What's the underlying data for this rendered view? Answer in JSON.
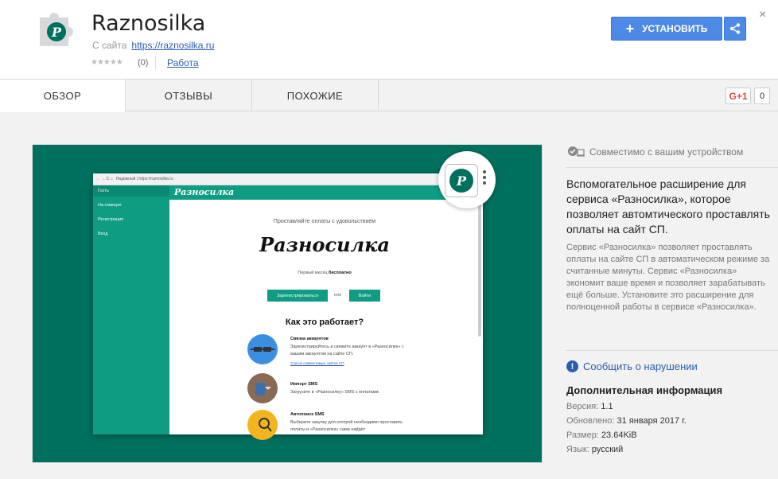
{
  "header": {
    "title": "Raznosilka",
    "from_site_label": "С сайта",
    "from_site_url": "https://raznosilka.ru",
    "rating_stars": "★★★★★",
    "rating_count": "(0)",
    "category": "Работа",
    "install_label": "УСТАНОВИТЬ",
    "close_symbol": "×"
  },
  "tabs": [
    {
      "label": "ОБЗОР",
      "active": true
    },
    {
      "label": "ОТЗЫВЫ",
      "active": false
    },
    {
      "label": "ПОХОЖИЕ",
      "active": false
    }
  ],
  "gplus": {
    "label": "G+1",
    "count": "0"
  },
  "screenshot": {
    "address_bar": "Надежный | https://raznosilka.ru",
    "sidebar_items": [
      "Гость",
      "На главную",
      "Регистрация",
      "Вход"
    ],
    "top_brand": "Разносилка",
    "subtitle": "Проставляйте оплаты с удовольствием",
    "logo": "Разносилка",
    "first_month_prefix": "Первый месяц ",
    "first_month_bold": "бесплатно",
    "register_btn": "Зарегистрироваться",
    "or_text": "или",
    "login_btn": "Войти",
    "how_title": "Как это работает?",
    "steps": [
      {
        "title": "Связка аккаунтов",
        "text": "Зарегистрируйтесь и свяжите аккаунт в «Разносилке» с вашим аккаунтом на сайте СП.",
        "link": "Список совместимых сайтов СП"
      },
      {
        "title": "Импорт SMS",
        "text": "Загрузите в «Разносилку» SMS с оплатами."
      },
      {
        "title": "Автопоиск SMS",
        "text": "Выберите закупку для которой необходимо проставить оплаты и «Разносилка» сама найдёт"
      }
    ],
    "bubble_letter": "P"
  },
  "sidebar": {
    "compat": "Совместимо с вашим устройством",
    "lead": "Вспомогательное расширение для сервиса «Разносилка», которое позволяет автомтического проставлять оплаты на сайт СП.",
    "body": "Сервис «Разносилка» позволяет проставлять оплаты на сайте СП в автоматическом режиме за считанные минуты. Сервис «Разносилка» экономит ваше время и позволяет зарабатывать ещё больше. Установите это расширение для полноценной работы в сервисе «Разносилка».",
    "report": "Сообщить о нарушении",
    "addl_title": "Дополнительная информация",
    "version_label": "Версия:",
    "version": "1.1",
    "updated_label": "Обновлено:",
    "updated": "31 января 2017 г.",
    "size_label": "Размер:",
    "size": "23.64KiB",
    "lang_label": "Язык:",
    "lang": "русский"
  },
  "colors": {
    "accent": "#4d8ae6",
    "brand": "#00705e",
    "brand_light": "#0e9c82",
    "link": "#2a5db0"
  }
}
